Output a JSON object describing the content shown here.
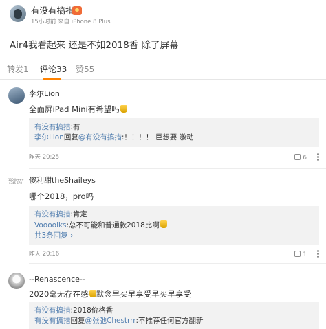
{
  "post": {
    "author": "有没有搞措",
    "meta": "15小时前 来自 iPhone 8 Plus",
    "body": "Air4我看起来 还是不如2018香 除了屏幕"
  },
  "tabs": {
    "repost": "转发1",
    "comment": "评论33",
    "like": "赞55"
  },
  "comments": [
    {
      "name": "李尔Lion",
      "text": "全面屏iPad Mini有希望吗",
      "replies": [
        {
          "author": "有没有搞措",
          "body": ":有"
        },
        {
          "author": "李尔Lion",
          "mid": "回复",
          "mention": "@有没有搞措",
          "body": ":！！！！ 巨想要 激动"
        }
      ],
      "time": "昨天 20:25",
      "likes": "6"
    },
    {
      "name": "傻利甜theShaileys",
      "text": "哪个2018，pro吗",
      "replies": [
        {
          "author": "有没有搞措",
          "body": ":肯定"
        },
        {
          "author": "Vooooiks",
          "body": ":总不可能和普通款2018比啊"
        }
      ],
      "more_replies": "共3条回复 ›",
      "time": "昨天 20:16",
      "likes": "1"
    },
    {
      "name": "--Renascence--",
      "text_a": "2020毫无存在感",
      "text_b": "默念早买早享受早买早享受",
      "replies": [
        {
          "author": "有没有搞措",
          "body": ":2018价格香"
        },
        {
          "author": "有没有搞措",
          "mid": "回复",
          "mention": "@张弛Chestrrr",
          "body": ":不推荐任何官方翻新"
        }
      ]
    }
  ],
  "avatar_text": "1000k+++ +345 678",
  "colors": {
    "accent": "#ff8200",
    "link": "#507daf",
    "reply_bg": "#f2f2f2"
  }
}
